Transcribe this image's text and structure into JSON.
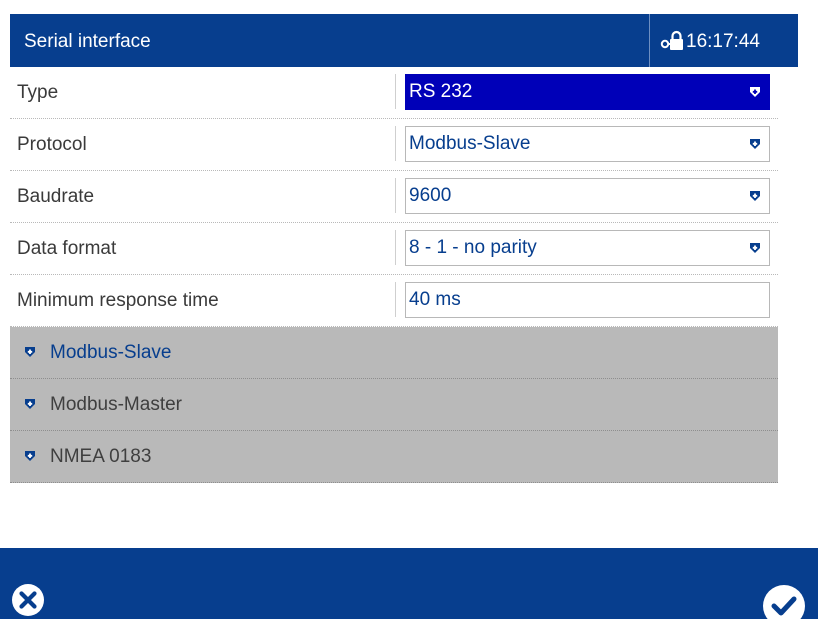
{
  "header": {
    "title": "Serial interface",
    "time": "16:17:44",
    "lock_icon": "login-key-icon"
  },
  "fields": [
    {
      "label": "Type",
      "value": "RS 232",
      "kind": "dropdown",
      "focused": true
    },
    {
      "label": "Protocol",
      "value": "Modbus-Slave",
      "kind": "dropdown"
    },
    {
      "label": "Baudrate",
      "value": "9600",
      "kind": "dropdown"
    },
    {
      "label": "Data format",
      "value": "8 - 1 - no parity",
      "kind": "dropdown"
    },
    {
      "label": "Minimum response time",
      "value": "40 ms",
      "kind": "input"
    }
  ],
  "sections": [
    {
      "label": "Modbus-Slave",
      "current": true
    },
    {
      "label": "Modbus-Master"
    },
    {
      "label": "NMEA 0183"
    }
  ],
  "footer": {
    "cancel_icon": "cancel-icon",
    "ok_icon": "confirm-icon"
  },
  "colors": {
    "accent": "#073e8e",
    "focused_field": "#0000b8",
    "section_background": "#b9b9b9"
  }
}
